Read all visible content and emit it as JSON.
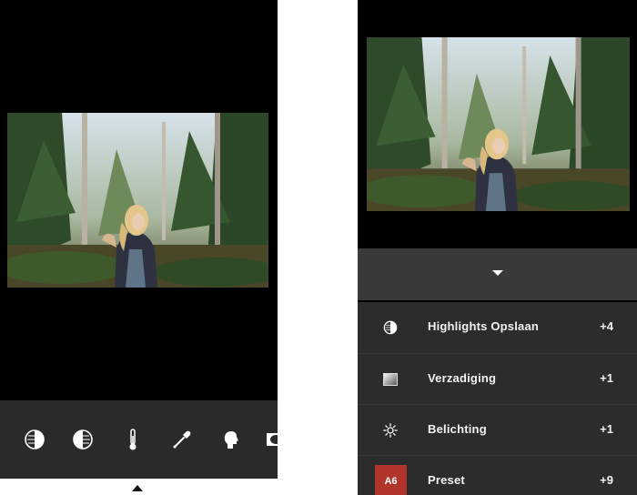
{
  "left_screen": {
    "toolbar": {
      "tools": [
        {
          "icon": "highlights-save-icon"
        },
        {
          "icon": "shadows-save-icon"
        },
        {
          "icon": "temperature-icon"
        },
        {
          "icon": "eyedropper-icon"
        },
        {
          "icon": "skin-tone-icon"
        },
        {
          "icon": "vignette-icon"
        }
      ]
    }
  },
  "right_screen": {
    "adjustments": [
      {
        "icon": "highlights-save-icon",
        "label": "Highlights Opslaan",
        "value": "+4"
      },
      {
        "icon": "saturation-icon",
        "label": "Verzadiging",
        "value": "+1"
      },
      {
        "icon": "exposure-icon",
        "label": "Belichting",
        "value": "+1"
      },
      {
        "badge": "A6",
        "label": "Preset",
        "value": "+9"
      }
    ]
  },
  "colors": {
    "toolbar_bg": "#2a2a2a",
    "panel_bg": "#2c2c2c",
    "collapse_bg": "#393939",
    "preset_badge": "#b1342b"
  }
}
